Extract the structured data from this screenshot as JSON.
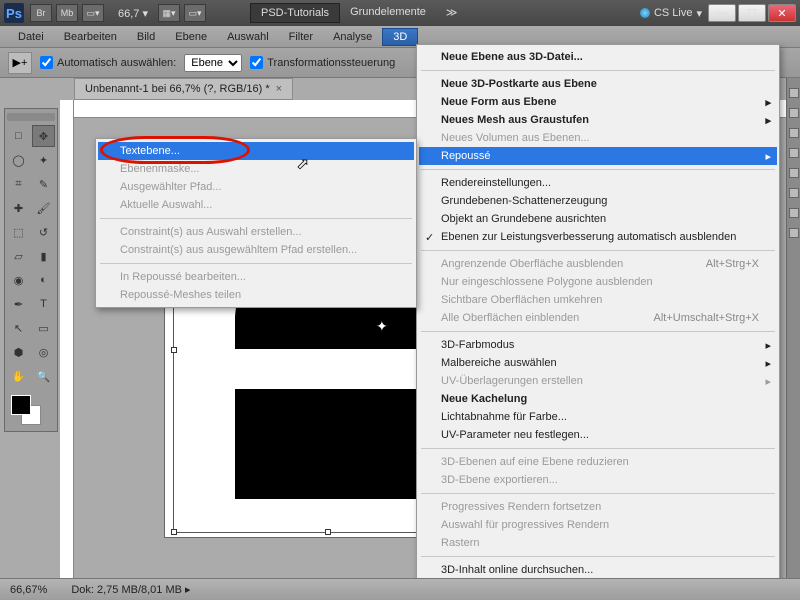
{
  "titlebar": {
    "zoom": "66,7",
    "tab_active": "PSD-Tutorials",
    "tab_other": "Grundelemente",
    "cs_live": "CS Live"
  },
  "menubar": {
    "items": [
      "Datei",
      "Bearbeiten",
      "Bild",
      "Ebene",
      "Auswahl",
      "Filter",
      "Analyse",
      "3D"
    ]
  },
  "optbar": {
    "auto_select": "Automatisch auswählen:",
    "target": "Ebene",
    "transform": "Transformationssteuerung"
  },
  "doc_tab": "Unbenannt-1 bei 66,7% (?, RGB/16) *",
  "main_menu": {
    "items": [
      {
        "label": "Neue Ebene aus 3D-Datei...",
        "bold": true
      },
      {
        "sep": true
      },
      {
        "label": "Neue 3D-Postkarte aus Ebene",
        "bold": true
      },
      {
        "label": "Neue Form aus Ebene",
        "bold": true,
        "arrow": true
      },
      {
        "label": "Neues Mesh aus Graustufen",
        "bold": true,
        "arrow": true
      },
      {
        "label": "Neues Volumen aus Ebenen...",
        "disabled": true
      },
      {
        "label": "Repoussé",
        "hl": true,
        "arrow": true
      },
      {
        "sep": true
      },
      {
        "label": "Rendereinstellungen..."
      },
      {
        "label": "Grundebenen-Schattenerzeugung"
      },
      {
        "label": "Objekt an Grundebene ausrichten"
      },
      {
        "label": "Ebenen zur Leistungsverbesserung automatisch ausblenden",
        "check": true
      },
      {
        "sep": true
      },
      {
        "label": "Angrenzende Oberfläche ausblenden",
        "disabled": true,
        "shortcut": "Alt+Strg+X"
      },
      {
        "label": "Nur eingeschlossene Polygone ausblenden",
        "disabled": true
      },
      {
        "label": "Sichtbare Oberflächen umkehren",
        "disabled": true
      },
      {
        "label": "Alle Oberflächen einblenden",
        "disabled": true,
        "shortcut": "Alt+Umschalt+Strg+X"
      },
      {
        "sep": true
      },
      {
        "label": "3D-Farbmodus",
        "arrow": true
      },
      {
        "label": "Malbereiche auswählen",
        "arrow": true
      },
      {
        "label": "UV-Überlagerungen erstellen",
        "disabled": true,
        "arrow": true
      },
      {
        "label": "Neue Kachelung",
        "bold": true
      },
      {
        "label": "Lichtabnahme für Farbe..."
      },
      {
        "label": "UV-Parameter neu festlegen..."
      },
      {
        "sep": true
      },
      {
        "label": "3D-Ebenen auf eine Ebene reduzieren",
        "disabled": true
      },
      {
        "label": "3D-Ebene exportieren...",
        "disabled": true
      },
      {
        "sep": true
      },
      {
        "label": "Progressives Rendern fortsetzen",
        "disabled": true
      },
      {
        "label": "Auswahl für progressives Rendern",
        "disabled": true
      },
      {
        "label": "Rastern",
        "disabled": true
      },
      {
        "sep": true
      },
      {
        "label": "3D-Inhalt online durchsuchen..."
      }
    ]
  },
  "sub_menu": {
    "items": [
      {
        "label": "Textebene...",
        "hl": true
      },
      {
        "label": "Ebenenmaske...",
        "disabled": true
      },
      {
        "label": "Ausgewählter Pfad...",
        "disabled": true
      },
      {
        "label": "Aktuelle Auswahl...",
        "disabled": true
      },
      {
        "sep": true
      },
      {
        "label": "Constraint(s) aus Auswahl erstellen...",
        "disabled": true
      },
      {
        "label": "Constraint(s) aus ausgewähltem Pfad erstellen...",
        "disabled": true
      },
      {
        "sep": true
      },
      {
        "label": "In Repoussé bearbeiten...",
        "disabled": true
      },
      {
        "label": "Repoussé-Meshes teilen",
        "disabled": true
      }
    ]
  },
  "statusbar": {
    "zoom": "66,67%",
    "dok": "Dok: 2,75 MB/8,01 MB"
  }
}
